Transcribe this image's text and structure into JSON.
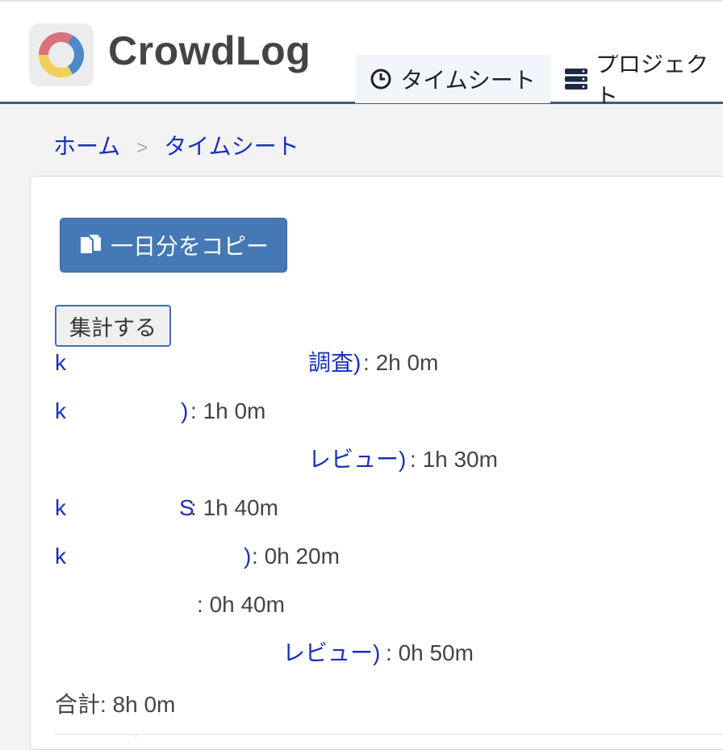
{
  "header": {
    "brand": "CrowdLog",
    "tabs": [
      {
        "label": "タイムシート",
        "icon": "clock-icon",
        "active": true
      },
      {
        "label": "プロジェクト",
        "icon": "server-stack-icon",
        "active": false
      }
    ]
  },
  "breadcrumb": {
    "home": "ホーム",
    "separator": ">",
    "current": "タイムシート"
  },
  "actions": {
    "copy_label": "一日分をコピー",
    "aggregate_label": "集計する"
  },
  "entries": [
    {
      "prefix": "k",
      "project": "調査)",
      "sep": ":",
      "duration": "2h 0m"
    },
    {
      "prefix": "k",
      "project": ")",
      "sep": ":",
      "duration": "1h 0m"
    },
    {
      "prefix": "",
      "project": "レビュー)",
      "sep": ":",
      "duration": "1h 30m"
    },
    {
      "prefix": "k",
      "project": "S",
      "sep": ":",
      "duration": "1h 40m"
    },
    {
      "prefix": "k",
      "project": ")",
      "sep": ":",
      "duration": "0h 20m"
    },
    {
      "prefix": "",
      "project": "",
      "sep": ":",
      "duration": "0h 40m"
    },
    {
      "prefix": "",
      "project": "レビュー)",
      "sep": ":",
      "duration": "0h 50m"
    }
  ],
  "total": "合計: 8h 0m",
  "colors": {
    "accent": "#4479b5",
    "link": "#1a2fbb",
    "header_rule": "#3a5b8c"
  }
}
